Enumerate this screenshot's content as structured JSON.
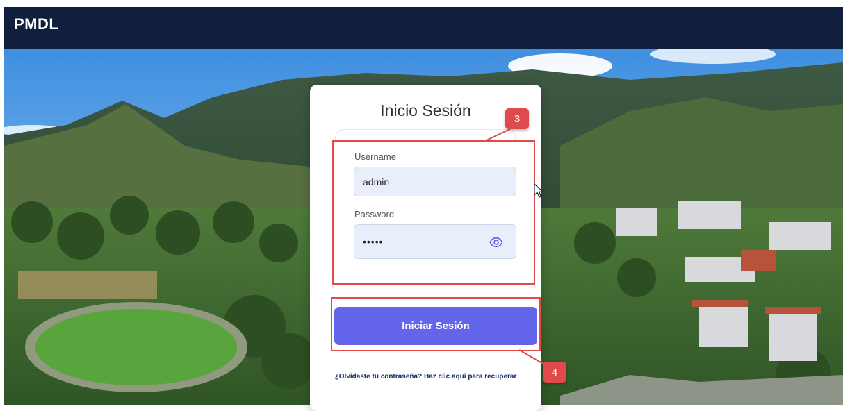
{
  "app": {
    "brand": "PMDL"
  },
  "login": {
    "title": "Inicio Sesión",
    "username_label": "Username",
    "username_value": "admin",
    "password_label": "Password",
    "password_value": "•••••",
    "submit_label": "Iniciar Sesión",
    "recover_link": "¿Olvidaste tu contraseña? Haz clic aqui para recuperar"
  },
  "annotations": {
    "step_credentials": "3",
    "step_submit": "4"
  },
  "colors": {
    "topbar": "#0f1f3d",
    "button": "#6366ea",
    "annotation": "#e04a4a",
    "field_bg": "#e8eefa"
  },
  "icons": {
    "password_toggle": "eye-icon",
    "cursor": "mouse-pointer-icon"
  }
}
